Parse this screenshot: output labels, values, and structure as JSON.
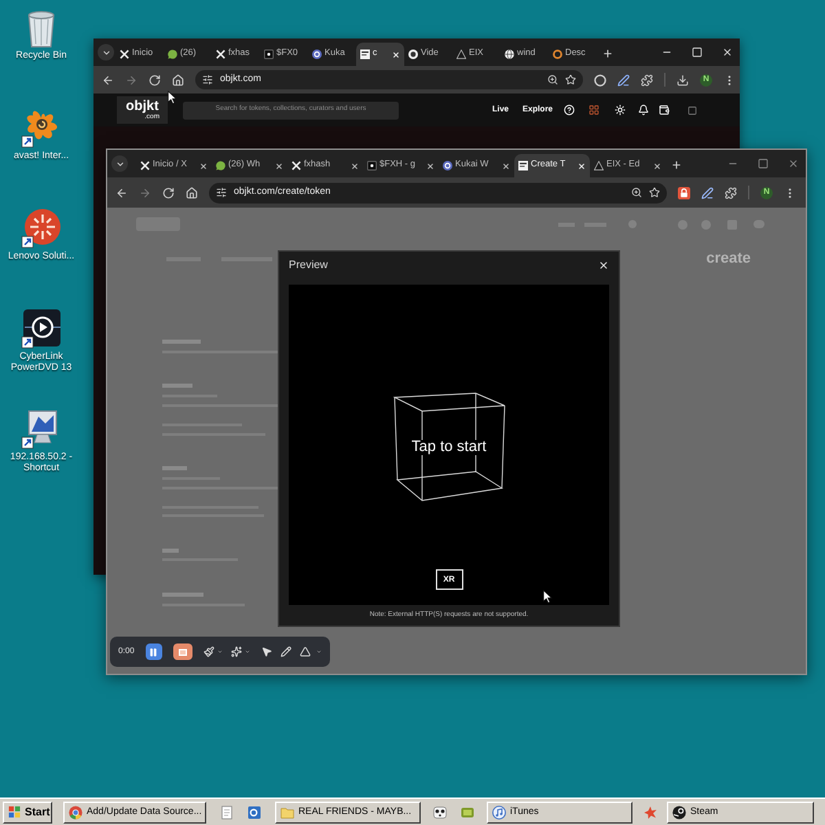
{
  "desktop_icons": [
    {
      "kind": "bin",
      "label": "Recycle Bin"
    },
    {
      "kind": "splat",
      "label": "avast! Inter..."
    },
    {
      "kind": "emblem",
      "label": "Lenovo Soluti..."
    },
    {
      "kind": "player",
      "label": "CyberLink PowerDVD 13"
    },
    {
      "kind": "computer",
      "label": "192.168.50.2 - Shortcut"
    }
  ],
  "back_window": {
    "tabs": [
      {
        "kind": "xmark",
        "title": "Inicio",
        "selected": false
      },
      {
        "kind": "chat",
        "title": "(26)",
        "selected": false
      },
      {
        "kind": "xmark",
        "title": "fxhas",
        "selected": false
      },
      {
        "kind": "tile",
        "title": "$FX0",
        "selected": false
      },
      {
        "kind": "wallet",
        "title": "Kuka",
        "selected": false
      },
      {
        "kind": "page",
        "title": "c",
        "selected": true
      },
      {
        "kind": "record",
        "title": "Vide",
        "selected": false
      },
      {
        "kind": "triangle",
        "title": "EIX",
        "selected": false
      },
      {
        "kind": "globe",
        "title": "wind",
        "selected": false
      },
      {
        "kind": "ring",
        "title": "Desc",
        "selected": false
      }
    ],
    "address": "objkt.com",
    "profile": "N",
    "site_header": {
      "logo": "objkt",
      "logo_suffix": ".com",
      "search_placeholder": "Search for tokens, collections, curators and users",
      "nav": [
        "Live",
        "Explore"
      ]
    }
  },
  "front_window": {
    "tabs": [
      {
        "kind": "xmark",
        "title": "Inicio / X",
        "selected": false
      },
      {
        "kind": "chat",
        "title": "(26) Wh",
        "selected": false
      },
      {
        "kind": "xmark",
        "title": "fxhash",
        "selected": false
      },
      {
        "kind": "tile",
        "title": "$FXH - g",
        "selected": false
      },
      {
        "kind": "wallet",
        "title": "Kukai W",
        "selected": false
      },
      {
        "kind": "page",
        "title": "Create T",
        "selected": true
      },
      {
        "kind": "triangle",
        "title": "EIX - Ed",
        "selected": false
      }
    ],
    "address": "objkt.com/create/token",
    "profile": "N",
    "page_heading": "create",
    "preview": {
      "title": "Preview",
      "prompt": "Tap to start",
      "xr_button": "XR",
      "note": "Note: External HTTP(S) requests are not supported."
    }
  },
  "recorder": {
    "time": "0:00"
  },
  "taskbar": {
    "start": "Start",
    "tasks": [
      {
        "kind": "browser",
        "label": "Add/Update Data Source..."
      },
      {
        "kind": "folder",
        "label": "REAL FRIENDS - MAYB..."
      },
      {
        "kind": "music",
        "label": "iTunes"
      },
      {
        "kind": "steam",
        "label": "Steam"
      }
    ]
  }
}
